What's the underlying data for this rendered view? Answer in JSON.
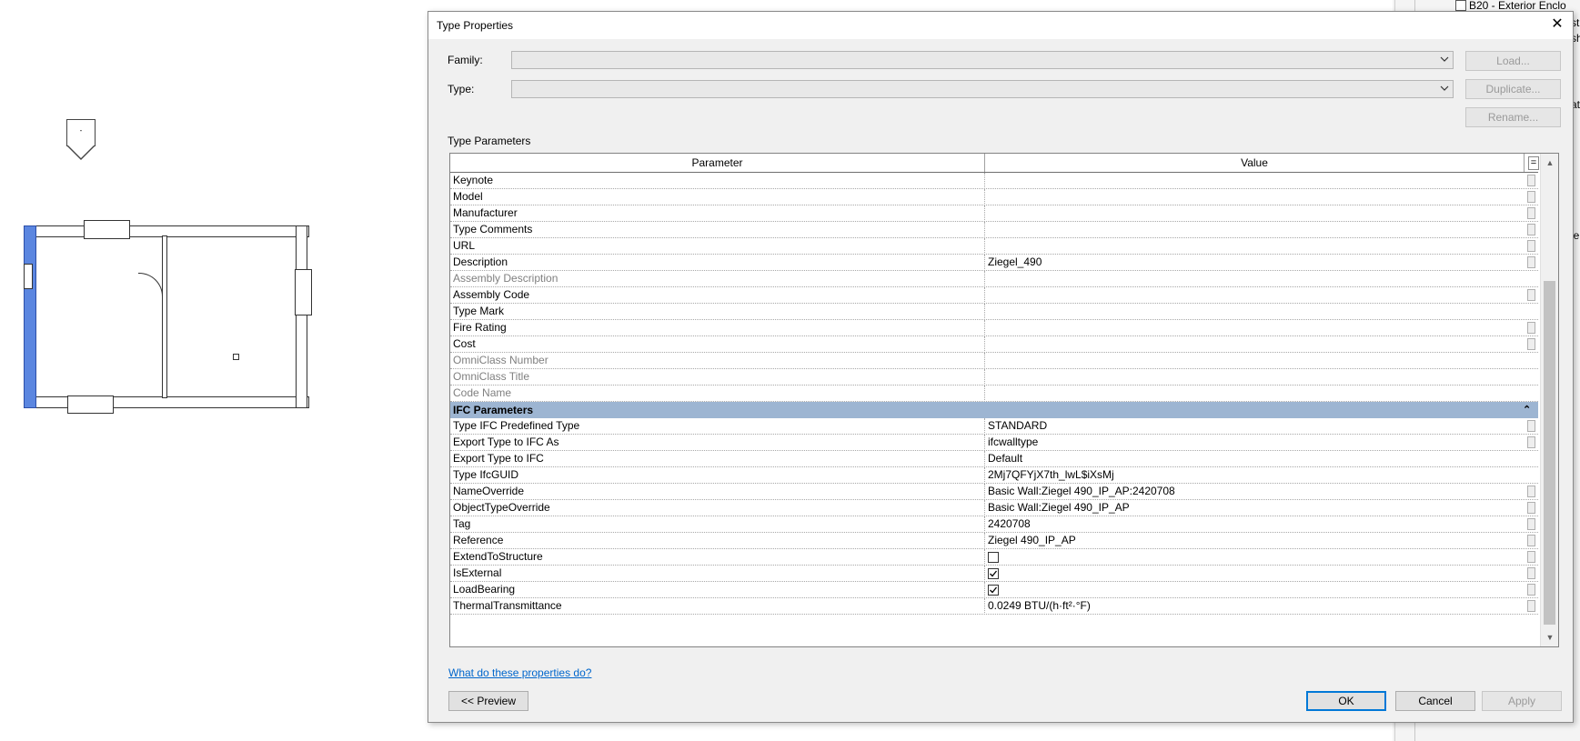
{
  "browser": {
    "item_label": "B20 - Exterior Enclo",
    "edge_chars": [
      "st",
      "sh",
      "at",
      "le"
    ]
  },
  "plan": {
    "tag_text": "-"
  },
  "dialog": {
    "title": "Type Properties",
    "family_label": "Family:",
    "type_label": "Type:",
    "family_value": "",
    "type_value": "",
    "load_label": "Load...",
    "duplicate_label": "Duplicate...",
    "rename_label": "Rename...",
    "section_label": "Type Parameters",
    "col_parameter": "Parameter",
    "col_value": "Value",
    "rows_a": [
      {
        "p": "Keynote",
        "v": ""
      },
      {
        "p": "Model",
        "v": ""
      },
      {
        "p": "Manufacturer",
        "v": ""
      },
      {
        "p": "Type Comments",
        "v": ""
      },
      {
        "p": "URL",
        "v": ""
      },
      {
        "p": "Description",
        "v": "Ziegel_490"
      },
      {
        "p": "Assembly Description",
        "v": ""
      },
      {
        "p": "Assembly Code",
        "v": ""
      },
      {
        "p": "Type Mark",
        "v": ""
      },
      {
        "p": "Fire Rating",
        "v": ""
      },
      {
        "p": "Cost",
        "v": ""
      },
      {
        "p": "OmniClass Number",
        "v": ""
      },
      {
        "p": "OmniClass Title",
        "v": ""
      },
      {
        "p": "Code Name",
        "v": ""
      }
    ],
    "group_title": "IFC Parameters",
    "rows_b": [
      {
        "p": "Type IFC Predefined Type",
        "v": "STANDARD"
      },
      {
        "p": "Export Type to IFC As",
        "v": "ifcwalltype"
      },
      {
        "p": "Export Type to IFC",
        "v": "Default"
      },
      {
        "p": "Type IfcGUID",
        "v": "2Mj7QFYjX7th_lwL$iXsMj"
      },
      {
        "p": "NameOverride",
        "v": "Basic Wall:Ziegel 490_IP_AP:2420708"
      },
      {
        "p": "ObjectTypeOverride",
        "v": "Basic Wall:Ziegel 490_IP_AP"
      },
      {
        "p": "Tag",
        "v": "2420708"
      },
      {
        "p": "Reference",
        "v": "Ziegel 490_IP_AP"
      },
      {
        "p": "ExtendToStructure",
        "v": ""
      },
      {
        "p": "IsExternal",
        "v": ""
      },
      {
        "p": "LoadBearing",
        "v": ""
      },
      {
        "p": "ThermalTransmittance",
        "v": "0.0249 BTU/(h·ft²·°F)"
      }
    ],
    "checkboxes": {
      "ExtendToStructure": false,
      "IsExternal": true,
      "LoadBearing": true
    },
    "help_link": "What do these properties do?",
    "preview_label": "<< Preview",
    "ok_label": "OK",
    "cancel_label": "Cancel",
    "apply_label": "Apply"
  }
}
